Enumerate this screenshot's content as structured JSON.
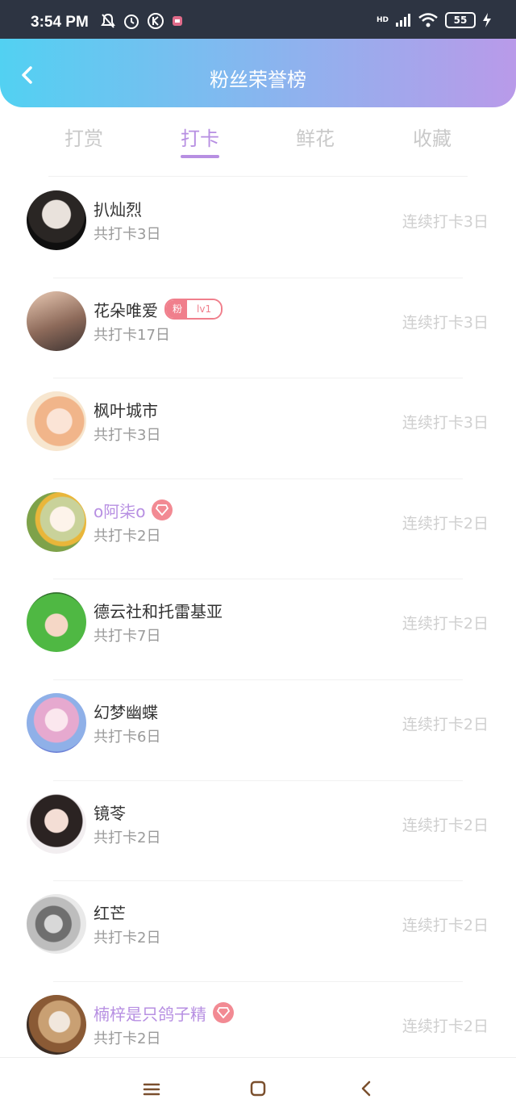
{
  "status": {
    "time": "3:54 PM",
    "network": "HD",
    "battery": "55"
  },
  "header": {
    "title": "粉丝荣誉榜"
  },
  "tabs": [
    {
      "label": "打赏"
    },
    {
      "label": "打卡"
    },
    {
      "label": "鲜花"
    },
    {
      "label": "收藏"
    }
  ],
  "active_tab": "打卡",
  "rows": [
    {
      "name": "扒灿烈",
      "count": "共打卡3日",
      "streak": "连续打卡3日",
      "badge": ""
    },
    {
      "name": "花朵唯爱",
      "count": "共打卡17日",
      "streak": "连续打卡3日",
      "badge": "fan",
      "badge_left": "粉",
      "badge_right": "lv1"
    },
    {
      "name": "枫叶城市",
      "count": "共打卡3日",
      "streak": "连续打卡3日",
      "badge": ""
    },
    {
      "name": "o阿柒o",
      "count": "共打卡2日",
      "streak": "连续打卡2日",
      "badge": "diamond"
    },
    {
      "name": "德云社和托雷基亚",
      "count": "共打卡7日",
      "streak": "连续打卡2日",
      "badge": ""
    },
    {
      "name": "幻梦幽蝶",
      "count": "共打卡6日",
      "streak": "连续打卡2日",
      "badge": ""
    },
    {
      "name": "镜苓",
      "count": "共打卡2日",
      "streak": "连续打卡2日",
      "badge": ""
    },
    {
      "name": "红芒",
      "count": "共打卡2日",
      "streak": "连续打卡2日",
      "badge": ""
    },
    {
      "name": "楠梓是只鸽子精",
      "count": "共打卡2日",
      "streak": "连续打卡2日",
      "badge": "diamond"
    }
  ],
  "colors": {
    "accent": "#b78fe2",
    "header_start": "#52d1f2",
    "header_end": "#b99ae9",
    "badge_pink": "#f07f8c"
  }
}
